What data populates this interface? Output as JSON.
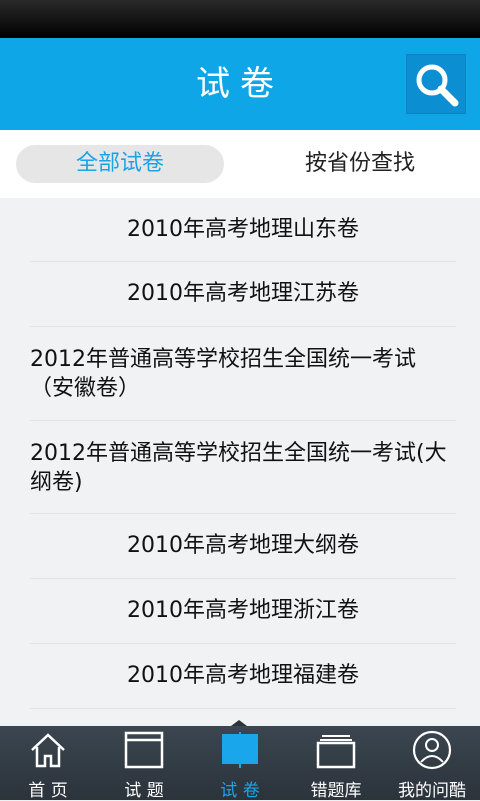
{
  "header": {
    "title": "试卷"
  },
  "segments": {
    "all_label": "全部试卷",
    "province_label": "按省份查找"
  },
  "papers": [
    "2010年高考地理山东卷",
    "2010年高考地理江苏卷",
    "2012年普通高等学校招生全国统一考试（安徽卷）",
    "2012年普通高等学校招生全国统一考试(大纲卷)",
    "2010年高考地理大纲卷",
    "2010年高考地理浙江卷",
    "2010年高考地理福建卷"
  ],
  "tabs": [
    {
      "label": "首 页",
      "icon": "home-icon"
    },
    {
      "label": "试 题",
      "icon": "question-window-icon"
    },
    {
      "label": "试 卷",
      "icon": "open-book-icon",
      "active": true
    },
    {
      "label": "错题库",
      "icon": "stack-icon"
    },
    {
      "label": "我的问酷",
      "icon": "user-icon"
    }
  ],
  "colors": {
    "accent": "#0fa6e8",
    "active_tab": "#19a6ea",
    "tabbar": "#2f3841"
  }
}
